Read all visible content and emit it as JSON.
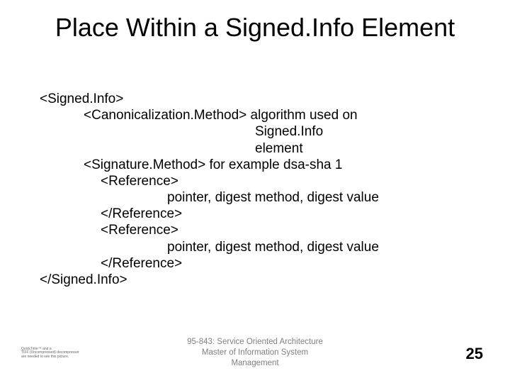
{
  "title": "Place Within a Signed.Info Element",
  "lines": {
    "l0": "<Signed.Info>",
    "l1": "<Canonicalization.Method> algorithm used on",
    "l2": "Signed.Info",
    "l3": "element",
    "l4": "<Signature.Method> for example dsa-sha 1",
    "l5": "<Reference>",
    "l6": "pointer, digest method, digest value",
    "l7": "</Reference>",
    "l8": "<Reference>",
    "l9": "pointer, digest method, digest value",
    "l10": "</Reference>",
    "l11": "</Signed.Info>"
  },
  "footer": {
    "course": "95-843: Service Oriented Architecture",
    "dept1": "Master of Information System",
    "dept2": "Management"
  },
  "qt": {
    "a": "QuickTime™ and a",
    "b": "TIFF (Uncompressed) decompressor",
    "c": "are needed to see this picture."
  },
  "page": "25"
}
